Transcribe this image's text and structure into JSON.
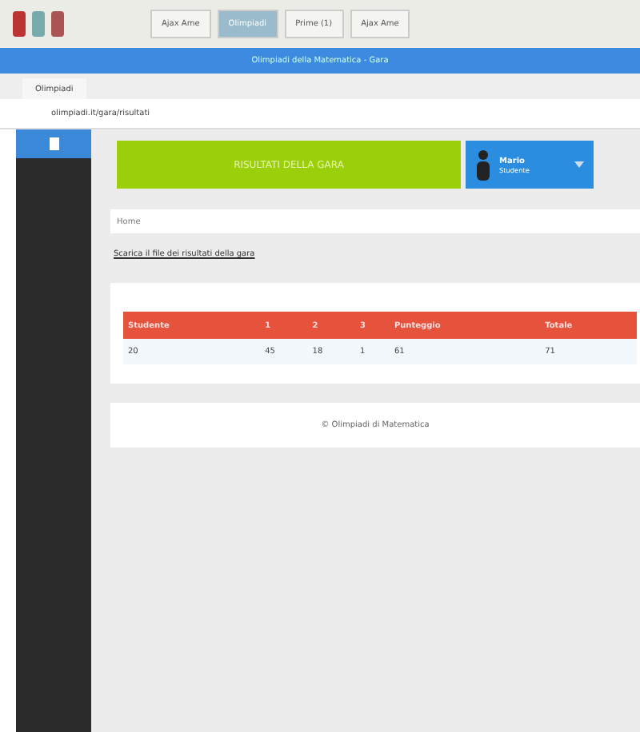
{
  "taskbar": {
    "tasks": [
      {
        "label": "Ajax Ame",
        "selected": false
      },
      {
        "label": "Olimpiadi",
        "selected": true
      },
      {
        "label": "Prime (1)",
        "selected": false
      },
      {
        "label": "Ajax Ame",
        "selected": false
      }
    ]
  },
  "window": {
    "title": "Olimpiadi della Matematica - Gara"
  },
  "tabs": [
    {
      "label": "Olimpiadi",
      "selected": true
    }
  ],
  "address_bar": {
    "value": "olimpiadi.it/gara/risultati"
  },
  "banner": {
    "label": "RISULTATI DELLA GARA"
  },
  "user_menu": {
    "name": "Mario",
    "role": "Studente"
  },
  "breadcrumb": "Home",
  "link": "Scarica il file dei risultati della gara",
  "table": {
    "columns": [
      "Studente",
      "1",
      "2",
      "3",
      "Punteggio",
      "Totale"
    ],
    "rows": [
      [
        "20",
        "45",
        "18",
        "1",
        "61",
        "71"
      ]
    ]
  },
  "footer": "© Olimpiadi di Matematica"
}
